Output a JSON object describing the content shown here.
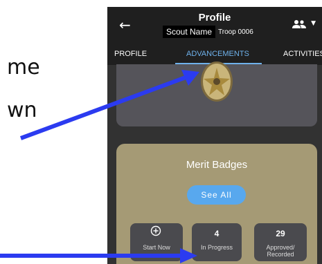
{
  "side_text": {
    "line1": "me",
    "line2": "wn"
  },
  "header": {
    "back_icon": "arrow-left-icon",
    "title": "Profile",
    "scout_name": "Scout Name",
    "troop": "Troop 0006",
    "people_icon": "people-icon",
    "dropdown_icon": "caret-down-icon"
  },
  "tabs": [
    {
      "label": "PROFILE",
      "active": false
    },
    {
      "label": "ADVANCEMENTS",
      "active": true
    },
    {
      "label": "ACTIVITIES",
      "active": false
    }
  ],
  "rank_card": {
    "badge_icon": "rank-badge-icon"
  },
  "merit_badges": {
    "title": "Merit Badges",
    "see_all": "See All",
    "stats": [
      {
        "value": "",
        "label": "Start Now",
        "icon": "plus-circle-icon"
      },
      {
        "value": "4",
        "label": "In Progress"
      },
      {
        "value": "29",
        "label": "Approved/\nRecorded"
      }
    ]
  },
  "colors": {
    "accent": "#6fb2ec",
    "header_bg": "#1f1f1f",
    "merit_card": "#a59a75",
    "annotation_arrow": "#2b3bf0"
  }
}
